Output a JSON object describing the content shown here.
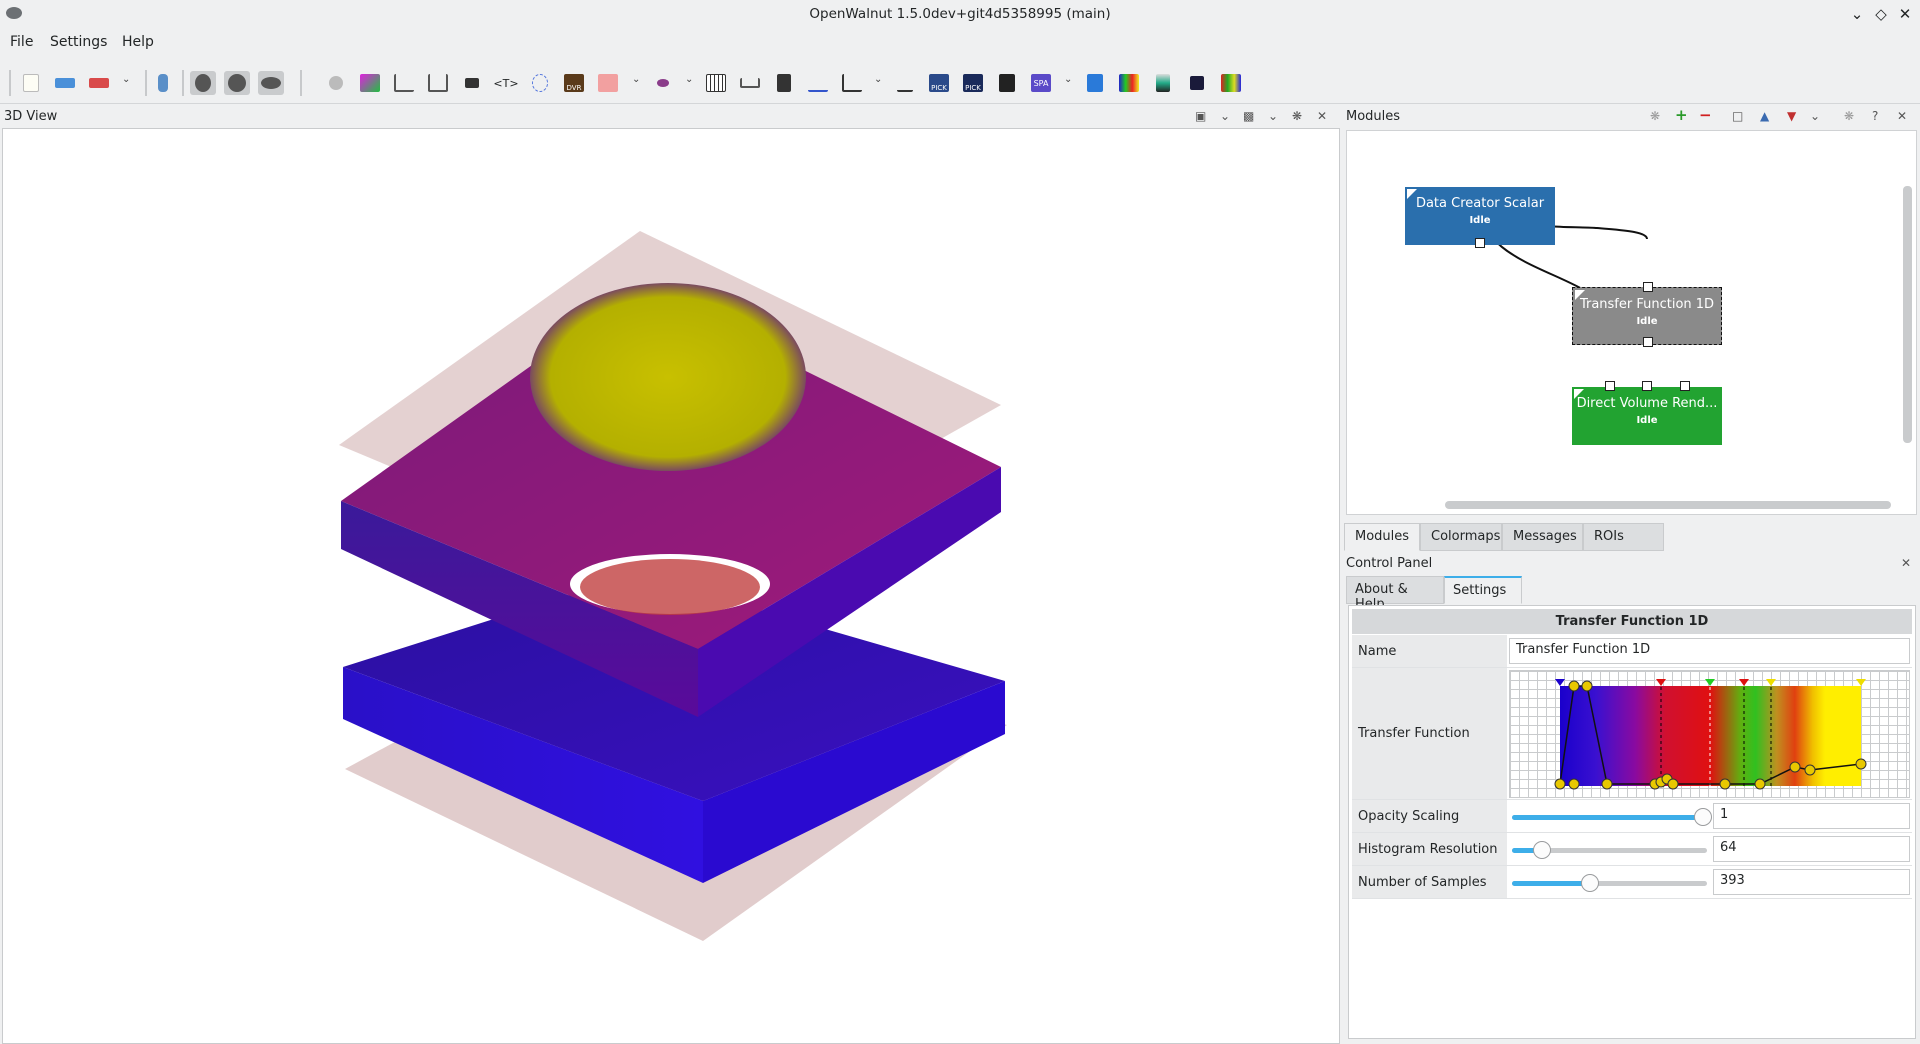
{
  "window": {
    "title": "OpenWalnut 1.5.0dev+git4d5358995 (main)"
  },
  "menu": {
    "file": "File",
    "settings": "Settings",
    "help": "Help"
  },
  "toolbar": {
    "text_module_label": "<T>",
    "dvr_label": "DVR",
    "pick_label": "PICK",
    "spa_label": "SPA"
  },
  "view3d": {
    "title": "3D View"
  },
  "modules_panel": {
    "title": "Modules",
    "nodes": [
      {
        "name": "Data Creator Scalar",
        "status": "Idle",
        "color": "#2a6fad"
      },
      {
        "name": "Transfer Function 1D",
        "status": "Idle",
        "color": "#8a8a8a"
      },
      {
        "name": "Direct Volume Rend...",
        "status": "Idle",
        "color": "#22a331"
      }
    ]
  },
  "bottom_tabs": {
    "modules": "Modules",
    "colormaps": "Colormaps",
    "messages": "Messages",
    "rois": "ROIs"
  },
  "control_panel": {
    "title": "Control Panel",
    "tabs": {
      "about": "About & Help",
      "settings": "Settings"
    },
    "module_title": "Transfer Function 1D",
    "props": {
      "name_label": "Name",
      "name_value": "Transfer Function 1D",
      "tf_label": "Transfer Function",
      "opacity_label": "Opacity Scaling",
      "opacity_value": "1",
      "opacity_fraction": 1.0,
      "histres_label": "Histogram Resolution",
      "histres_value": "64",
      "histres_fraction": 0.15,
      "samples_label": "Number of Samples",
      "samples_value": "393",
      "samples_fraction": 0.4
    }
  }
}
